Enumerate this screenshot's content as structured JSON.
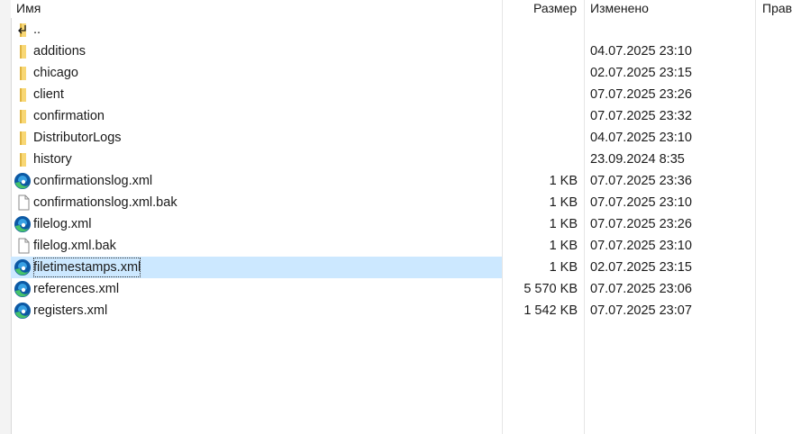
{
  "columns": {
    "name": "Имя",
    "size": "Размер",
    "modified": "Изменено",
    "rights": "Прав"
  },
  "files": [
    {
      "name": "..",
      "size": "",
      "modified": "",
      "icon": "parent-folder-icon",
      "selected": false
    },
    {
      "name": "additions",
      "size": "",
      "modified": "04.07.2025 23:10",
      "icon": "folder-icon",
      "selected": false
    },
    {
      "name": "chicago",
      "size": "",
      "modified": "02.07.2025 23:15",
      "icon": "folder-icon",
      "selected": false
    },
    {
      "name": "client",
      "size": "",
      "modified": "07.07.2025 23:26",
      "icon": "folder-icon",
      "selected": false
    },
    {
      "name": "confirmation",
      "size": "",
      "modified": "07.07.2025 23:32",
      "icon": "folder-icon",
      "selected": false
    },
    {
      "name": "DistributorLogs",
      "size": "",
      "modified": "04.07.2025 23:10",
      "icon": "folder-icon",
      "selected": false
    },
    {
      "name": "history",
      "size": "",
      "modified": "23.09.2024 8:35",
      "icon": "folder-icon",
      "selected": false
    },
    {
      "name": "confirmationslog.xml",
      "size": "1 KB",
      "modified": "07.07.2025 23:36",
      "icon": "edge-xml-icon",
      "selected": false
    },
    {
      "name": "confirmationslog.xml.bak",
      "size": "1 KB",
      "modified": "07.07.2025 23:10",
      "icon": "blank-file-icon",
      "selected": false
    },
    {
      "name": "filelog.xml",
      "size": "1 KB",
      "modified": "07.07.2025 23:26",
      "icon": "edge-xml-icon",
      "selected": false
    },
    {
      "name": "filelog.xml.bak",
      "size": "1 KB",
      "modified": "07.07.2025 23:10",
      "icon": "blank-file-icon",
      "selected": false
    },
    {
      "name": "filetimestamps.xml",
      "size": "1 KB",
      "modified": "02.07.2025 23:15",
      "icon": "edge-xml-icon",
      "selected": true
    },
    {
      "name": "references.xml",
      "size": "5 570 KB",
      "modified": "07.07.2025 23:06",
      "icon": "edge-xml-icon",
      "selected": false
    },
    {
      "name": "registers.xml",
      "size": "1 542 KB",
      "modified": "07.07.2025 23:07",
      "icon": "edge-xml-icon",
      "selected": false
    }
  ],
  "colors": {
    "selection": "#cce8ff",
    "folder": "#f8d775",
    "edge_blue": "#0c59a4",
    "edge_green": "#47c36a"
  }
}
